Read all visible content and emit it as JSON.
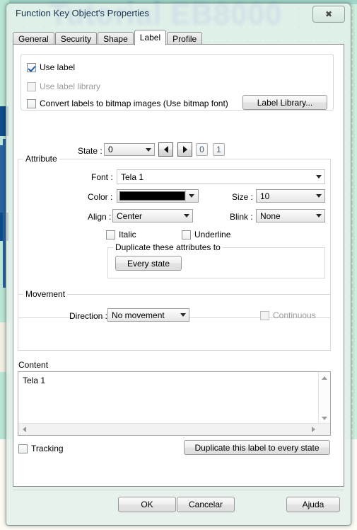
{
  "desktop": {
    "watermark_text": "Tutorial EB8000"
  },
  "window": {
    "title": "Function Key Object's Properties",
    "close_icon": "close-x-icon"
  },
  "tabs": [
    {
      "label": "General",
      "active": false
    },
    {
      "label": "Security",
      "active": false
    },
    {
      "label": "Shape",
      "active": false
    },
    {
      "label": "Label",
      "active": true
    },
    {
      "label": "Profile",
      "active": false
    }
  ],
  "label_panel": {
    "use_label": {
      "text": "Use label",
      "checked": true,
      "disabled": false
    },
    "use_label_library": {
      "text": "Use label library",
      "checked": false,
      "disabled": true
    },
    "convert_bitmap": {
      "text": "Convert labels to bitmap images (Use bitmap font)",
      "checked": false,
      "disabled": false
    },
    "label_library_button": "Label Library..."
  },
  "state_row": {
    "label": "State :",
    "value": "0",
    "prev_icon": "arrow-left-icon",
    "next_icon": "arrow-right-icon",
    "state_buttons": [
      "0",
      "1"
    ]
  },
  "attribute": {
    "group_title": "Attribute",
    "font_label": "Font :",
    "font_value": "Tela 1",
    "color_label": "Color :",
    "color_value": "#000000",
    "size_label": "Size :",
    "size_value": "10",
    "align_label": "Align :",
    "align_value": "Center",
    "blink_label": "Blink :",
    "blink_value": "None",
    "italic": {
      "text": "Italic",
      "checked": false
    },
    "underline": {
      "text": "Underline",
      "checked": false
    },
    "duplicate_group_title": "Duplicate these attributes to",
    "every_state_button": "Every state"
  },
  "movement": {
    "group_title": "Movement",
    "direction_label": "Direction :",
    "direction_value": "No movement",
    "continuous": {
      "text": "Continuous",
      "checked": false,
      "disabled": true
    }
  },
  "content": {
    "group_title": "Content",
    "value": "Tela 1",
    "scroll_up_icon": "scroll-up-icon",
    "scroll_down_icon": "scroll-down-icon",
    "scroll_left_icon": "scroll-left-icon",
    "scroll_right_icon": "scroll-right-icon"
  },
  "bottom": {
    "tracking": {
      "text": "Tracking",
      "checked": false
    },
    "duplicate_label_button": "Duplicate this label to every state"
  },
  "footer": {
    "ok": "OK",
    "cancel": "Cancelar",
    "help": "Ajuda"
  },
  "colors": {
    "accent": "#1d5fa8",
    "desktop_mint": "#cdeedd",
    "desktop_blue": "#0d4d8c",
    "dialog_bg": "#e2f0ea"
  }
}
